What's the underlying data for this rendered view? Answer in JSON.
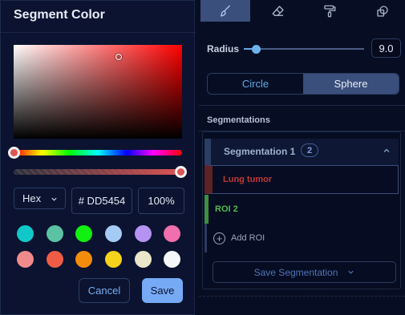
{
  "dialog": {
    "title": "Segment Color",
    "format": "Hex",
    "hex_value": "# DD5454",
    "alpha_value": "100%",
    "current_color": "#dd5454",
    "swatches": [
      "#11c8c9",
      "#5cc2a4",
      "#12f012",
      "#a5caf5",
      "#b493f2",
      "#f06fac",
      "#f08a8c",
      "#f05d46",
      "#f28c0c",
      "#f7d21c",
      "#eae6c9",
      "#f5f6f7"
    ],
    "cancel_label": "Cancel",
    "save_label": "Save"
  },
  "toolbar": {
    "tools": [
      "brush-icon",
      "eraser-icon",
      "paint-roller-icon",
      "threshold-icon"
    ],
    "active_tool": "brush-icon"
  },
  "brush": {
    "radius_label": "Radius",
    "radius_value": "9.0",
    "radius_fraction": 0.1,
    "shapes": [
      "Circle",
      "Sphere"
    ],
    "active_shape": "Sphere"
  },
  "segmentations": {
    "heading": "Segmentations",
    "group_title": "Segmentation 1",
    "group_count": "2",
    "items": [
      {
        "label": "Lung tumor",
        "color": "#c13838"
      },
      {
        "label": "ROI 2",
        "color": "#52b852"
      }
    ],
    "add_label": "Add ROI",
    "save_label": "Save Segmentation"
  }
}
